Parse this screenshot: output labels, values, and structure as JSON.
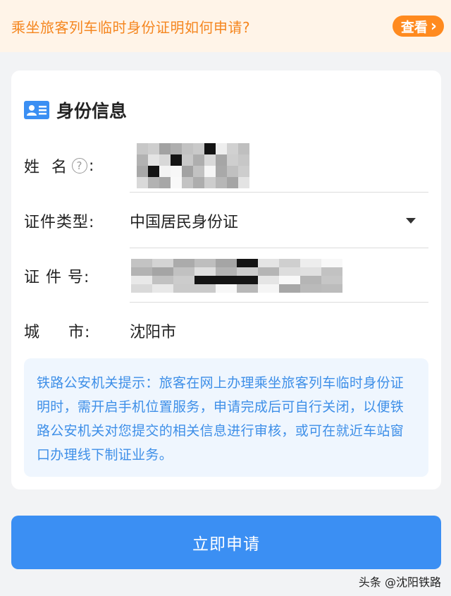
{
  "banner": {
    "text": "乘坐旅客列车临时身份证明如何申请?",
    "view_label": "查看",
    "view_chevron": "›"
  },
  "section": {
    "title": "身份信息",
    "icon": "id-card-icon"
  },
  "form": {
    "name_label": "姓  名",
    "name_colon": ":",
    "help_glyph": "?",
    "doc_type_label": "证件类型:",
    "doc_type_value": "中国居民身份证",
    "id_label": "证 件 号:",
    "city_label": "城     市:",
    "city_value": "沈阳市"
  },
  "notice": {
    "text": "铁路公安机关提示：旅客在网上办理乘坐旅客列车临时身份证明时，需开启手机位置服务，申请完成后可自行关闭，以便铁路公安机关对您提交的相关信息进行审核，或可在就近车站窗口办理线下制证业务。"
  },
  "apply_button": {
    "label": "立即申请"
  },
  "watermark": {
    "text": "头条 @沈阳铁路"
  },
  "colors": {
    "accent_blue": "#3b8ff3",
    "banner_orange": "#ff8a1f",
    "notice_text": "#3e8fe8"
  }
}
